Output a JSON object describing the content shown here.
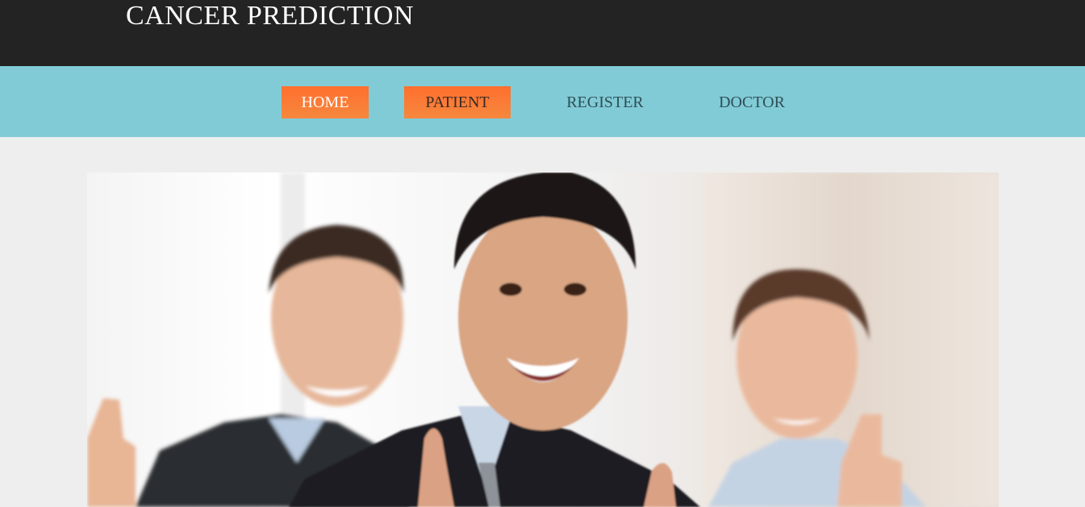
{
  "header": {
    "title": "CANCER PREDICTION"
  },
  "nav": {
    "items": [
      {
        "label": "HOME",
        "state": "active"
      },
      {
        "label": "PATIENT",
        "state": "highlight"
      },
      {
        "label": "REGISTER",
        "state": "normal"
      },
      {
        "label": "DOCTOR",
        "state": "normal"
      }
    ]
  },
  "hero": {
    "image": "happy-business-people-thumbs-up-photo"
  },
  "colors": {
    "header_bg": "#232323",
    "nav_bg": "#81cbd7",
    "nav_active": "#ff6f2e",
    "page_bg": "#eeeeee"
  }
}
